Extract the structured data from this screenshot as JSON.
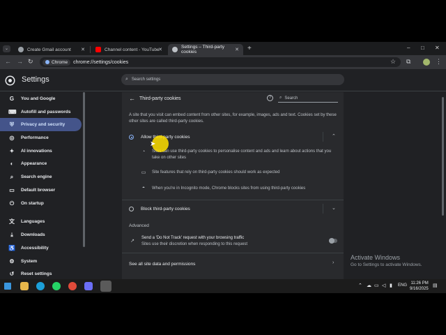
{
  "tabs": [
    {
      "title": "Create Gmail account",
      "favicon_color": "#9aa0a6"
    },
    {
      "title": "Channel content - YouTube Studio",
      "favicon_color": "#ff0000"
    },
    {
      "title": "Settings – Third-party cookies",
      "favicon_color": "#bdc1c6"
    }
  ],
  "window_controls": {
    "minimize": "–",
    "maximize": "□",
    "close": "✕"
  },
  "toolbar": {
    "chip_label": "Chrome",
    "url": "chrome://settings/cookies"
  },
  "header": {
    "title": "Settings",
    "search_placeholder": "Search settings"
  },
  "sidebar": {
    "items": [
      {
        "label": "You and Google",
        "icon": "G"
      },
      {
        "label": "Autofill and passwords",
        "icon": "⌨"
      },
      {
        "label": "Privacy and security",
        "icon": "⛨",
        "active": true
      },
      {
        "label": "Performance",
        "icon": "◎"
      },
      {
        "label": "AI innovations",
        "icon": "✦"
      },
      {
        "label": "Appearance",
        "icon": "◐"
      },
      {
        "label": "Search engine",
        "icon": "⌕"
      },
      {
        "label": "Default browser",
        "icon": "▭"
      },
      {
        "label": "On startup",
        "icon": "⏻"
      },
      {
        "label": "Languages",
        "icon": "文"
      },
      {
        "label": "Downloads",
        "icon": "⤓"
      },
      {
        "label": "Accessibility",
        "icon": "♿"
      },
      {
        "label": "System",
        "icon": "⚙"
      },
      {
        "label": "Reset settings",
        "icon": "↺"
      }
    ]
  },
  "main": {
    "title": "Third-party cookies",
    "search_placeholder": "Search",
    "description": "A site that you visit can embed content from other sites, for example, images, ads and text. Cookies set by these other sites are called third-party cookies.",
    "options": [
      {
        "label": "Allow third-party cookies",
        "selected": true,
        "sub_items": [
          {
            "icon": "cookie-icon",
            "text": "Sites can use third-party cookies to personalise content and ads and learn about actions that you take on other sites"
          },
          {
            "icon": "window-icon",
            "text": "Site features that rely on third-party cookies should work as expected"
          },
          {
            "icon": "incognito-icon",
            "text": "When you're in Incognito mode, Chrome blocks sites from using third-party cookies"
          }
        ]
      },
      {
        "label": "Block third-party cookies",
        "selected": false
      }
    ],
    "advanced_label": "Advanced",
    "dnt": {
      "title": "Send a 'Do Not Track' request with your browsing traffic",
      "subtitle": "Sites use their discretion when responding to this request",
      "enabled": false
    },
    "footer_link": "See all site data and permissions"
  },
  "watermark": {
    "line1": "Activate Windows",
    "line2": "Go to Settings to activate Windows."
  },
  "taskbar": {
    "tray_lang": "ENG",
    "time": "11:26 PM",
    "date": "9/16/2025"
  },
  "colors": {
    "accent": "#8ab4f8",
    "active_nav_bg": "#44548a",
    "cursor_highlight": "#ffe100"
  }
}
